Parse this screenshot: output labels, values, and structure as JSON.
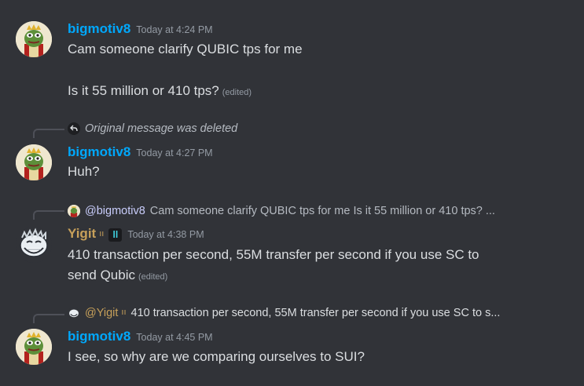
{
  "messages": [
    {
      "username": "bigmotiv8",
      "timestamp": "Today at 4:24 PM",
      "lines": [
        "Cam someone clarify QUBIC tps for me",
        "Is it 55 million or 410 tps?"
      ],
      "edited_label": "(edited)"
    },
    {
      "reply_deleted_text": "Original message was deleted",
      "username": "bigmotiv8",
      "timestamp": "Today at 4:27 PM",
      "lines": [
        "Huh?"
      ]
    },
    {
      "reply_mention": "@bigmotiv8",
      "reply_text": "Cam someone clarify QUBIC tps for me   Is it 55 million or 410 tps? ...",
      "username": "Yigit",
      "role_badge": "ıı",
      "app_badge": "ll",
      "timestamp": "Today at 4:38 PM",
      "lines": [
        "410 transaction per second, 55M transfer per second if you use SC to",
        "send Qubic"
      ],
      "edited_label": "(edited)"
    },
    {
      "reply_mention": "@Yigit",
      "reply_role_badge": "ıı",
      "reply_text": "410 transaction per second, 55M transfer per second if you use SC to s...",
      "username": "bigmotiv8",
      "timestamp": "Today at 4:45 PM",
      "lines": [
        "I see, so why are we comparing ourselves to SUI?"
      ]
    }
  ],
  "colors": {
    "background": "#313338",
    "username_blue": "#00a8fc",
    "username_gold": "#c7a05a",
    "text": "#dbdee1",
    "muted": "#949ba4"
  },
  "icons": {
    "pepe_avatar": "pepe-king-avatar-icon",
    "troll_avatar": "troll-face-avatar-icon",
    "reply_arrow": "reply-arrow-icon"
  }
}
